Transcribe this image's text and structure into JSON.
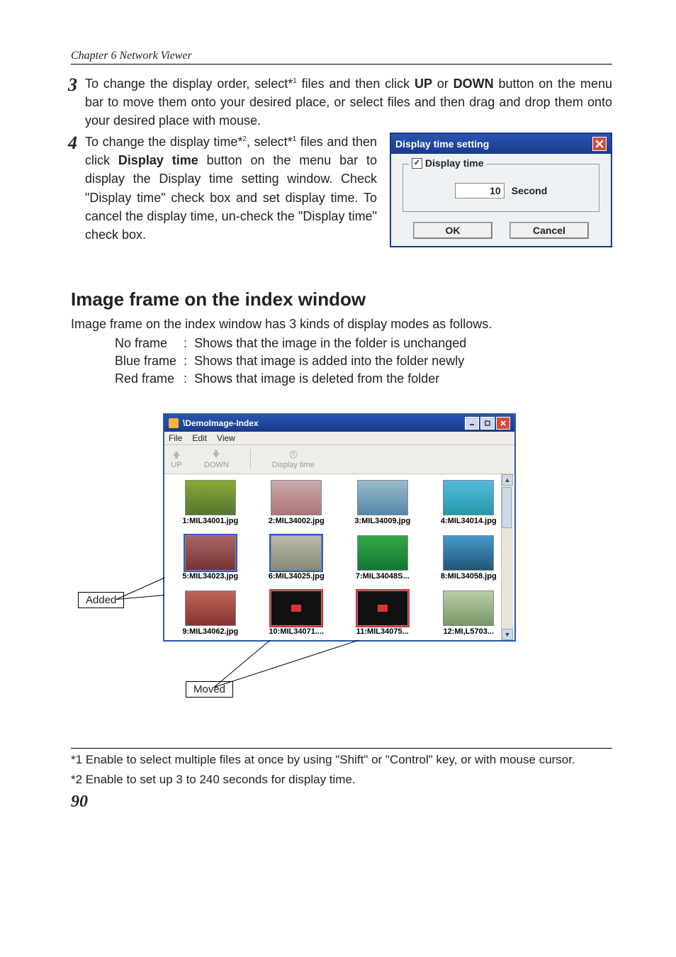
{
  "chapter": "Chapter 6 Network Viewer",
  "step3": {
    "num": "3",
    "pre": "To change the display order, select*",
    "sup1": "1",
    "mid1": " files and then click ",
    "up": "UP",
    "mid2": " or ",
    "down": "DOWN",
    "post": " button on the menu bar to move them onto your desired place, or select files and then drag and drop them onto your desired place with mouse."
  },
  "step4": {
    "num": "4",
    "pre": "To change the display time*",
    "sup1": "2",
    "mid1": ", select*",
    "sup2": "1",
    "mid2": " files and then click ",
    "btn": "Display time",
    "post": " button on the menu bar to display the Display time setting window. Check \"Display time\" check box and set display time. To cancel the display time, un-check the \"Display time\" check box."
  },
  "dialog": {
    "title": "Display time setting",
    "checkbox_label": "Display time",
    "value": "10",
    "unit": "Second",
    "ok": "OK",
    "cancel": "Cancel"
  },
  "h2": "Image frame on the index window",
  "para": "Image frame on the index window has 3 kinds of display modes as follows.",
  "modes": {
    "r1": {
      "k": "No frame",
      "v": "Shows that the image in the folder is unchanged"
    },
    "r2": {
      "k": "Blue frame",
      "v": "Shows that image is added into the folder newly"
    },
    "r3": {
      "k": "Red frame",
      "v": "Shows that image is deleted from the folder"
    }
  },
  "indexwin": {
    "title": "\\DemoImage-Index",
    "menu": {
      "file": "File",
      "edit": "Edit",
      "view": "View"
    },
    "toolbar": {
      "up": "UP",
      "down": "DOWN",
      "dt": "Display time"
    },
    "thumbs": [
      "1:MIL34001.jpg",
      "2:MIL34002.jpg",
      "3:MIL34009.jpg",
      "4:MIL34014.jpg",
      "5:MIL34023.jpg",
      "6:MIL34025.jpg",
      "7:MIL34048S...",
      "8:MIL34058.jpg",
      "9:MIL34062.jpg",
      "10:MIL34071....",
      "11:MIL34075...",
      "12:MI,L5703..."
    ]
  },
  "callouts": {
    "added": "Added",
    "moved": "Moved"
  },
  "footnotes": {
    "f1": "*1 Enable to select multiple files at once by using \"Shift\" or \"Control\" key, or with mouse cursor.",
    "f2": "*2 Enable to set up 3 to 240 seconds for display time."
  },
  "page_number": "90"
}
